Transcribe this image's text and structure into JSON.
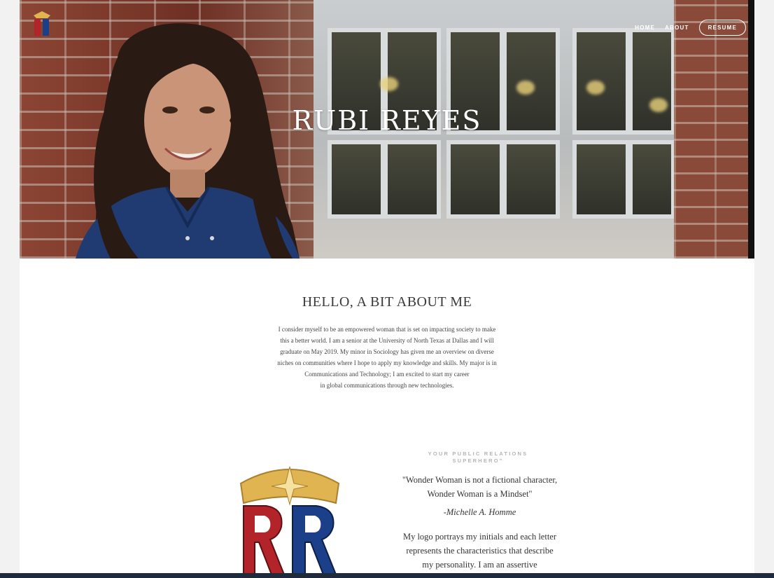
{
  "nav": {
    "home": "HOME",
    "about": "ABOUT",
    "resume": "RESUME",
    "logo_icon": "rr-shield-logo-icon"
  },
  "hero": {
    "title": "RUBI REYES"
  },
  "about": {
    "heading": "HELLO, A BIT ABOUT ME",
    "lines": [
      "I consider myself to be an empowered woman that is set on impacting society to make",
      "this a better world. I am a senior at the University of North Texas at Dallas and I will",
      "graduate on May 2019. My minor in Sociology has given me  an overview on diverse",
      "niches on communities where I hope to apply my knowledge and skills. My major is in",
      "Communications and Technology; I am excited to start my career",
      "in global communications through new technologies."
    ]
  },
  "brand": {
    "kicker_line1": "YOUR PUBLIC RELATIONS",
    "kicker_line2": "SUPERHERO\"",
    "quote": "\"Wonder Woman is not a fictional character, Wonder Woman is a Mindset\"",
    "author": "-Michelle A. Homme",
    "description": "My logo portrays my initials and each letter represents the characteristics that describe my personality. I am an assertive",
    "logo_icon": "rr-tiara-logo-icon"
  },
  "colors": {
    "logo_red": "#b3242a",
    "logo_blue": "#1c3f8a",
    "logo_gold": "#e0b451",
    "footer_bar": "#1f2b3a"
  }
}
